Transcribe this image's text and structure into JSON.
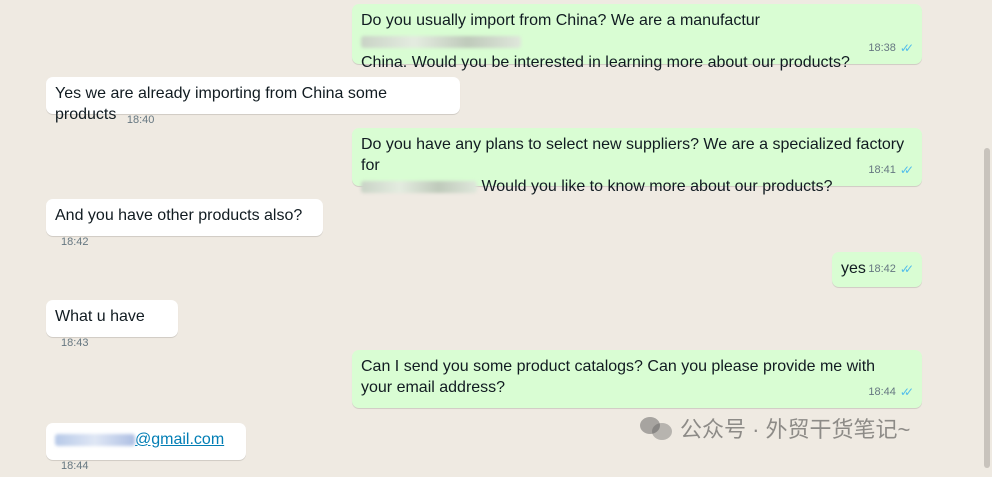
{
  "messages": [
    {
      "side": "out",
      "text_a": "Do you usually import from China? We are a manufactur",
      "text_b": "China. Would you be interested in learning more about our products?",
      "time": "18:38"
    },
    {
      "side": "in",
      "text": "Yes we are already importing from China some products",
      "time": "18:40"
    },
    {
      "side": "out",
      "text_a": "Do you have any plans to select new suppliers?  We are a specialized factory for",
      "text_b": "Would you like to know more about our products?",
      "time": "18:41"
    },
    {
      "side": "in",
      "text": "And you have other products also?",
      "time": "18:42"
    },
    {
      "side": "out",
      "text": "yes",
      "time": "18:42"
    },
    {
      "side": "in",
      "text": "What u have",
      "time": "18:43"
    },
    {
      "side": "out",
      "text": "Can I send you some product catalogs? Can you please provide me with your email address?",
      "time": "18:44"
    },
    {
      "side": "in",
      "text": "@gmail.com",
      "time": "18:44"
    }
  ],
  "watermark": {
    "text": "公众号 · 外贸干货笔记~"
  },
  "icons": {
    "read_receipt": "double-check-icon",
    "watermark_logo": "wechat-icon"
  }
}
